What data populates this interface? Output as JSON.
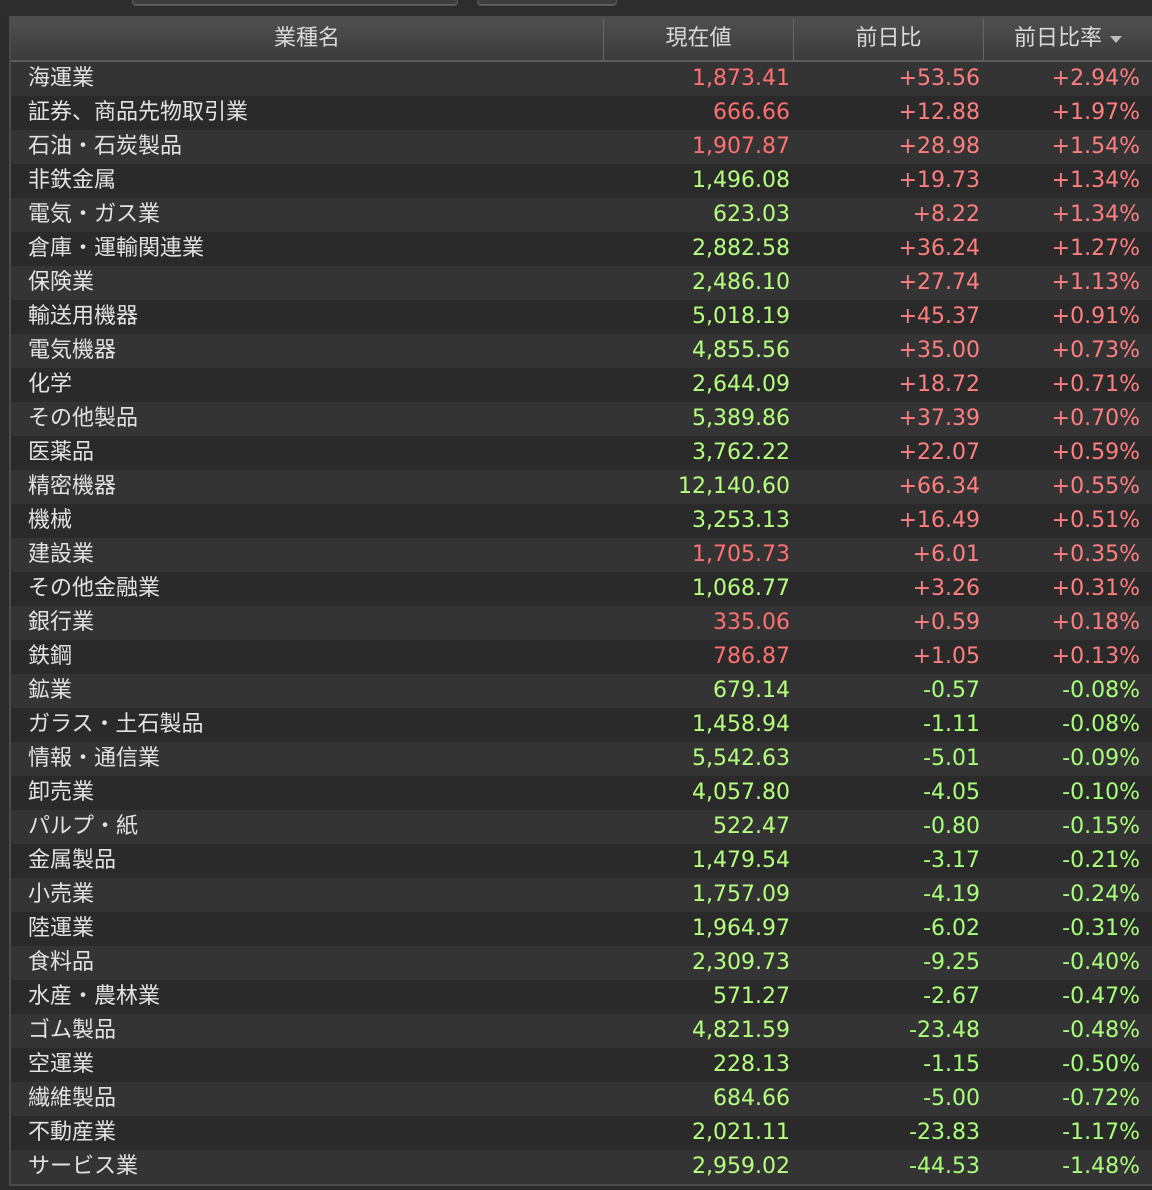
{
  "header": {
    "col_name": "業種名",
    "col_price": "現在値",
    "col_change": "前日比",
    "col_pct": "前日比率"
  },
  "rows": [
    {
      "name": "海運業",
      "price": "1,873.41",
      "price_color": "red",
      "change": "+53.56",
      "pct": "+2.94%"
    },
    {
      "name": "証券、商品先物取引業",
      "price": "666.66",
      "price_color": "red",
      "change": "+12.88",
      "pct": "+1.97%"
    },
    {
      "name": "石油・石炭製品",
      "price": "1,907.87",
      "price_color": "red",
      "change": "+28.98",
      "pct": "+1.54%"
    },
    {
      "name": "非鉄金属",
      "price": "1,496.08",
      "price_color": "green",
      "change": "+19.73",
      "pct": "+1.34%"
    },
    {
      "name": "電気・ガス業",
      "price": "623.03",
      "price_color": "green",
      "change": "+8.22",
      "pct": "+1.34%"
    },
    {
      "name": "倉庫・運輸関連業",
      "price": "2,882.58",
      "price_color": "green",
      "change": "+36.24",
      "pct": "+1.27%"
    },
    {
      "name": "保険業",
      "price": "2,486.10",
      "price_color": "green",
      "change": "+27.74",
      "pct": "+1.13%"
    },
    {
      "name": "輸送用機器",
      "price": "5,018.19",
      "price_color": "green",
      "change": "+45.37",
      "pct": "+0.91%"
    },
    {
      "name": "電気機器",
      "price": "4,855.56",
      "price_color": "green",
      "change": "+35.00",
      "pct": "+0.73%"
    },
    {
      "name": "化学",
      "price": "2,644.09",
      "price_color": "green",
      "change": "+18.72",
      "pct": "+0.71%"
    },
    {
      "name": "その他製品",
      "price": "5,389.86",
      "price_color": "green",
      "change": "+37.39",
      "pct": "+0.70%"
    },
    {
      "name": "医薬品",
      "price": "3,762.22",
      "price_color": "green",
      "change": "+22.07",
      "pct": "+0.59%"
    },
    {
      "name": "精密機器",
      "price": "12,140.60",
      "price_color": "green",
      "change": "+66.34",
      "pct": "+0.55%"
    },
    {
      "name": "機械",
      "price": "3,253.13",
      "price_color": "green",
      "change": "+16.49",
      "pct": "+0.51%"
    },
    {
      "name": "建設業",
      "price": "1,705.73",
      "price_color": "red",
      "change": "+6.01",
      "pct": "+0.35%"
    },
    {
      "name": "その他金融業",
      "price": "1,068.77",
      "price_color": "green",
      "change": "+3.26",
      "pct": "+0.31%"
    },
    {
      "name": "銀行業",
      "price": "335.06",
      "price_color": "red",
      "change": "+0.59",
      "pct": "+0.18%"
    },
    {
      "name": "鉄鋼",
      "price": "786.87",
      "price_color": "red",
      "change": "+1.05",
      "pct": "+0.13%"
    },
    {
      "name": "鉱業",
      "price": "679.14",
      "price_color": "green",
      "change": "-0.57",
      "pct": "-0.08%"
    },
    {
      "name": "ガラス・土石製品",
      "price": "1,458.94",
      "price_color": "green",
      "change": "-1.11",
      "pct": "-0.08%"
    },
    {
      "name": "情報・通信業",
      "price": "5,542.63",
      "price_color": "green",
      "change": "-5.01",
      "pct": "-0.09%"
    },
    {
      "name": "卸売業",
      "price": "4,057.80",
      "price_color": "green",
      "change": "-4.05",
      "pct": "-0.10%"
    },
    {
      "name": "パルプ・紙",
      "price": "522.47",
      "price_color": "green",
      "change": "-0.80",
      "pct": "-0.15%"
    },
    {
      "name": "金属製品",
      "price": "1,479.54",
      "price_color": "green",
      "change": "-3.17",
      "pct": "-0.21%"
    },
    {
      "name": "小売業",
      "price": "1,757.09",
      "price_color": "green",
      "change": "-4.19",
      "pct": "-0.24%"
    },
    {
      "name": "陸運業",
      "price": "1,964.97",
      "price_color": "green",
      "change": "-6.02",
      "pct": "-0.31%"
    },
    {
      "name": "食料品",
      "price": "2,309.73",
      "price_color": "green",
      "change": "-9.25",
      "pct": "-0.40%"
    },
    {
      "name": "水産・農林業",
      "price": "571.27",
      "price_color": "green",
      "change": "-2.67",
      "pct": "-0.47%"
    },
    {
      "name": "ゴム製品",
      "price": "4,821.59",
      "price_color": "green",
      "change": "-23.48",
      "pct": "-0.48%"
    },
    {
      "name": "空運業",
      "price": "228.13",
      "price_color": "green",
      "change": "-1.15",
      "pct": "-0.50%"
    },
    {
      "name": "繊維製品",
      "price": "684.66",
      "price_color": "green",
      "change": "-5.00",
      "pct": "-0.72%"
    },
    {
      "name": "不動産業",
      "price": "2,021.11",
      "price_color": "green",
      "change": "-23.83",
      "pct": "-1.17%"
    },
    {
      "name": "サービス業",
      "price": "2,959.02",
      "price_color": "green",
      "change": "-44.53",
      "pct": "-1.48%"
    }
  ],
  "colors": {
    "up": "#ff7f7f",
    "down": "#a8ff7a",
    "price_red": "#ff7070",
    "price_green": "#b5ff7e",
    "row_odd": "#343434",
    "row_even": "#2a2a2a"
  },
  "icons": {
    "sort": "sort-descending-icon"
  }
}
